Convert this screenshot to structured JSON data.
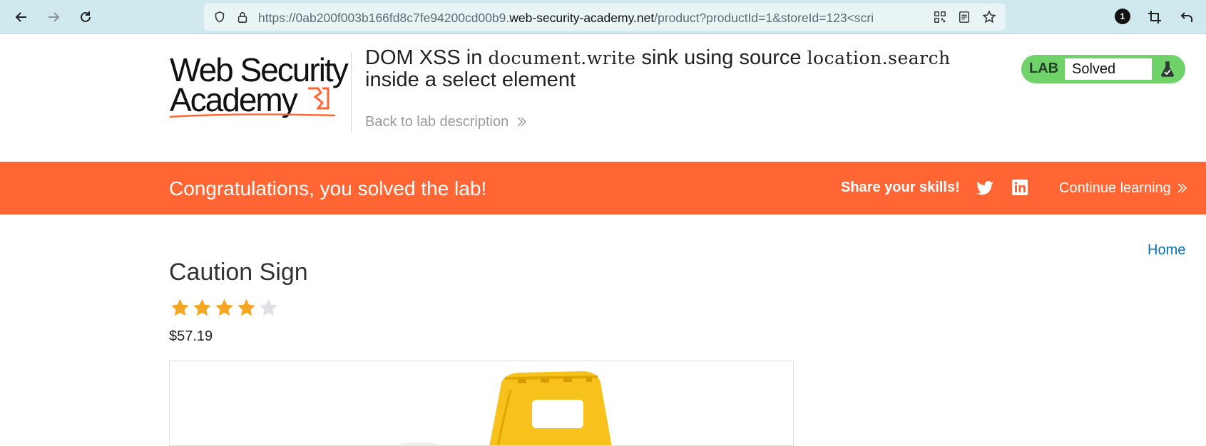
{
  "browser": {
    "url_prefix": "https://0ab200f003b166fd8c7fe94200cd00b9.",
    "url_domain": "web-security-academy.net",
    "url_suffix": "/product?productId=1&storeId=123<scri",
    "extensions_badge": "1"
  },
  "header": {
    "logo_line1": "Web Security",
    "logo_line2": "Academy",
    "title_part1": "DOM XSS in ",
    "title_code1": "document.write",
    "title_part2": " sink using source ",
    "title_code2": "location.search",
    "title_part3": "inside a select element",
    "back_link": "Back to lab description",
    "lab_label": "LAB",
    "lab_status": "Solved"
  },
  "banner": {
    "message": "Congratulations, you solved the lab!",
    "share_label": "Share your skills!",
    "continue_label": "Continue learning"
  },
  "content": {
    "home_link": "Home",
    "product_title": "Caution Sign",
    "rating": 4,
    "rating_max": 5,
    "price": "$57.19"
  },
  "colors": {
    "banner": "#ff6633",
    "lab_green": "#6fd36a",
    "link_blue": "#0071bc",
    "star_filled": "#f5a623",
    "star_empty": "#dde2e6"
  }
}
